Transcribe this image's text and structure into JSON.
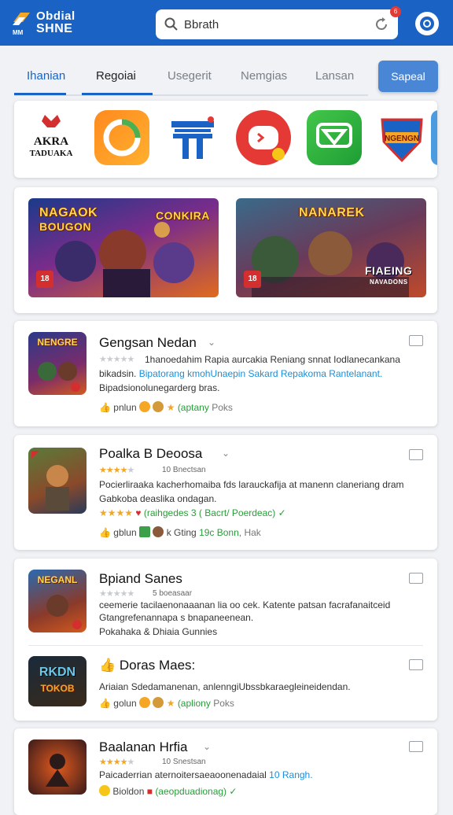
{
  "header": {
    "logo_line1": "Obdial",
    "logo_line2": "SHNE",
    "logo_small": "MM",
    "search_value": "Bbrath",
    "search_badge": "6"
  },
  "tabs": [
    {
      "label": "Ihanian"
    },
    {
      "label": "Regoiai"
    },
    {
      "label": "Usegerit"
    },
    {
      "label": "Nemgias"
    },
    {
      "label": "Lansan"
    }
  ],
  "tab_button": "Sapeal",
  "icon_row": {
    "first_icon_line1": "AKRA",
    "first_icon_line2": "TADUAKA",
    "last_icon_text": "NGENGN"
  },
  "banners": [
    {
      "title1": "NAGAOK",
      "title2": "BOUGON",
      "title3": "CONKIRA",
      "badge": "18"
    },
    {
      "title1": "NANAREK",
      "title2": "FIAEING",
      "title3": "NAVADONS",
      "badge": "18"
    }
  ],
  "games": [
    {
      "thumb_text": "NENGRE",
      "title": "Gengsan Nedan",
      "desc1": "1hanoedahim Rapia aurcakia Reniang snnat Iodlanecankana",
      "desc2a": "bikadsin.",
      "desc2b": "Bipatorang kmohUnaepin Sakard",
      "desc2c": "Repakoma Rantelanant.",
      "desc3": "Bipadsionolunegarderg bras.",
      "meta_a": "pnlun",
      "meta_b": "(aptany",
      "meta_c": "Poks"
    },
    {
      "thumb_text": "",
      "title": "Poalka B Deoosa",
      "rating_count": "10 Bnectsan",
      "desc1": "Pocierliraaka kacherhomaiba fds larauckafija at manenn claneriang dram",
      "desc2": "Gabkoba deaslika ondagan.",
      "meta_top_a": "(raihgedes 3 ( Bacrt/ Poerdeac)",
      "meta_a": "gblun",
      "meta_b": "k Gting",
      "meta_c": "19c Bonn,",
      "meta_d": "Hak"
    },
    {
      "thumb_text": "NEGANL",
      "title": "Bpiand Sanes",
      "rating_count": "5 boeasaar",
      "desc1": "ceemerie tacilaenonaaanan lia oo cek. Katente patsan facrafanaitceid",
      "desc2": "Gtangrefenannapa s bnapaneenean.",
      "desc3": "Pokahaka & Dhiaia Gunnies"
    },
    {
      "thumb_text": "RKDN",
      "thumb_text2": "TOKOB",
      "title": "Doras Maes:",
      "desc1": "Ariaian Sdedamanenan, anlenngiUbssbkaraegleineidendan.",
      "meta_a": "golun",
      "meta_b": "(apliony",
      "meta_c": "Poks"
    },
    {
      "thumb_text": "",
      "title": "Baalanan Hrfia",
      "rating_count": "10 Snestsan",
      "desc1a": "Paicaderrian aternoitersaeaoonenadaial",
      "desc1b": "10 Rangh.",
      "meta_a": "Bioldon",
      "meta_b": "(aeopduadionag)"
    }
  ]
}
